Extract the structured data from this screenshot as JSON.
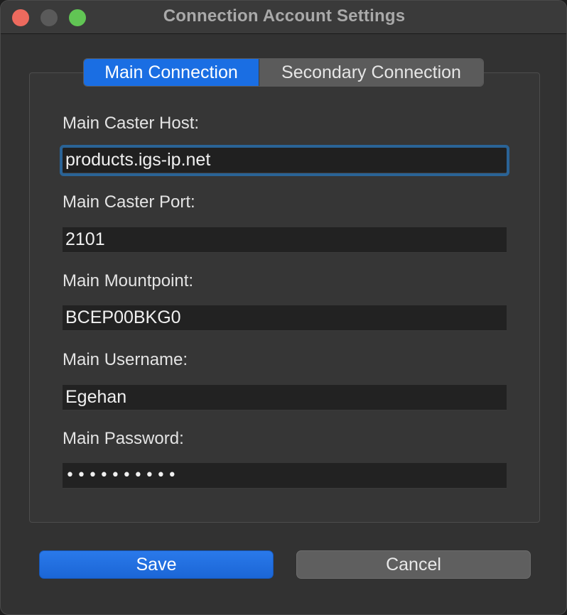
{
  "window": {
    "title": "Connection Account Settings"
  },
  "tabs": [
    {
      "label": "Main Connection",
      "active": true
    },
    {
      "label": "Secondary Connection",
      "active": false
    }
  ],
  "fields": {
    "host": {
      "label": "Main Caster Host:",
      "value": "products.igs-ip.net"
    },
    "port": {
      "label": "Main Caster Port:",
      "value": "2101"
    },
    "mountpoint": {
      "label": "Main Mountpoint:",
      "value": "BCEP00BKG0"
    },
    "username": {
      "label": "Main Username:",
      "value": "Egehan"
    },
    "password": {
      "label": "Main Password:",
      "value": "••••••••••"
    }
  },
  "buttons": {
    "save": "Save",
    "cancel": "Cancel"
  },
  "colors": {
    "accent": "#1a6ee3",
    "focus_ring": "#2a6396",
    "close": "#ed6a5e",
    "maximize": "#61c554"
  }
}
